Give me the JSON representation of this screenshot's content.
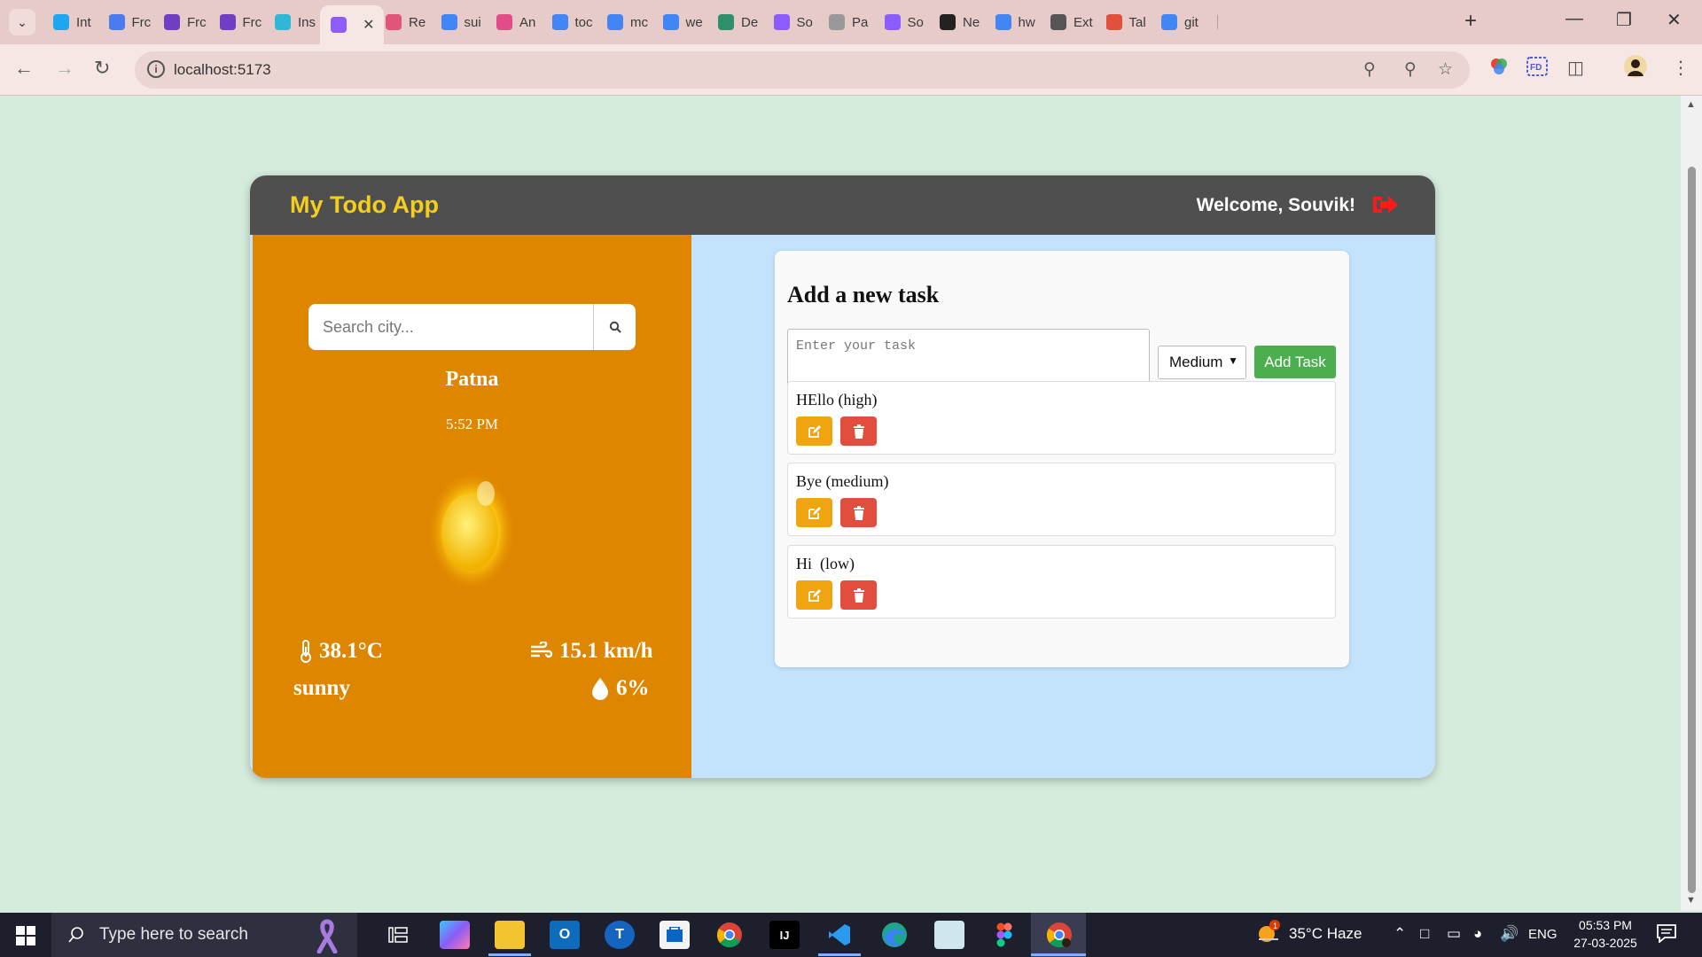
{
  "browser": {
    "tabs": [
      {
        "label": "Int",
        "icon": "instagram-favicon",
        "color": "#1ea7f0"
      },
      {
        "label": "Frc",
        "icon": "docs-favicon",
        "color": "#4a7bf0"
      },
      {
        "label": "Frc",
        "icon": "forms-favicon",
        "color": "#6e3fc2"
      },
      {
        "label": "Frc",
        "icon": "forms-favicon",
        "color": "#6e3fc2"
      },
      {
        "label": "Ins",
        "icon": "tailwind-favicon",
        "color": "#31b7d6"
      },
      {
        "label": "",
        "icon": "vite-favicon",
        "color": "#8c5cff",
        "active": true
      },
      {
        "label": "Re",
        "icon": "react-favicon",
        "color": "#e2557a"
      },
      {
        "label": "sui",
        "icon": "google-favicon",
        "color": "#4285f4"
      },
      {
        "label": "An",
        "icon": "dribbble-favicon",
        "color": "#e34c89"
      },
      {
        "label": "toc",
        "icon": "google-favicon",
        "color": "#4285f4"
      },
      {
        "label": "mc",
        "icon": "google-favicon",
        "color": "#4285f4"
      },
      {
        "label": "we",
        "icon": "google-favicon",
        "color": "#4285f4"
      },
      {
        "label": "De",
        "icon": "deepseek-favicon",
        "color": "#2f8f6d"
      },
      {
        "label": "So",
        "icon": "vite-favicon",
        "color": "#8c5cff"
      },
      {
        "label": "Pa",
        "icon": "globe-favicon",
        "color": "#999999"
      },
      {
        "label": "So",
        "icon": "vite-favicon",
        "color": "#8c5cff"
      },
      {
        "label": "Ne",
        "icon": "github-favicon",
        "color": "#222222"
      },
      {
        "label": "hw",
        "icon": "google-favicon",
        "color": "#4285f4"
      },
      {
        "label": "Ext",
        "icon": "puzzle-favicon",
        "color": "#555555"
      },
      {
        "label": "Tal",
        "icon": "rainbow-favicon",
        "color": "#e0503a"
      },
      {
        "label": "git",
        "icon": "google-favicon",
        "color": "#4285f4"
      }
    ],
    "url": "localhost:5173"
  },
  "app": {
    "title": "My Todo App",
    "welcome": "Welcome, Souvik!",
    "colors": {
      "header": "#4f4f4f",
      "title": "#f5cd1d",
      "weather_panel": "#df8600",
      "todo_bg": "#c3e2fb",
      "add_button": "#4cae4f",
      "edit_button": "#f0a40f",
      "delete_button": "#e34d3d",
      "logout_icon": "#ff1a1a"
    }
  },
  "weather": {
    "search_placeholder": "Search city...",
    "city": "Patna",
    "time": "5:52 PM",
    "temperature": "38.1°C",
    "wind": "15.1 km/h",
    "condition": "sunny",
    "humidity": "6%",
    "icon": "sun-icon"
  },
  "todo": {
    "heading": "Add a new task",
    "input_placeholder": "Enter your task",
    "priority_selected": "Medium",
    "add_label": "Add Task",
    "tasks": [
      {
        "label": "HEllo (high)"
      },
      {
        "label": "Bye (medium)"
      },
      {
        "label": "Hi  (low)"
      }
    ]
  },
  "taskbar": {
    "search_placeholder": "Type here to search",
    "weather": "35°C  Haze",
    "weather_badge": "1",
    "language": "ENG",
    "time": "05:53 PM",
    "date": "27-03-2025"
  }
}
